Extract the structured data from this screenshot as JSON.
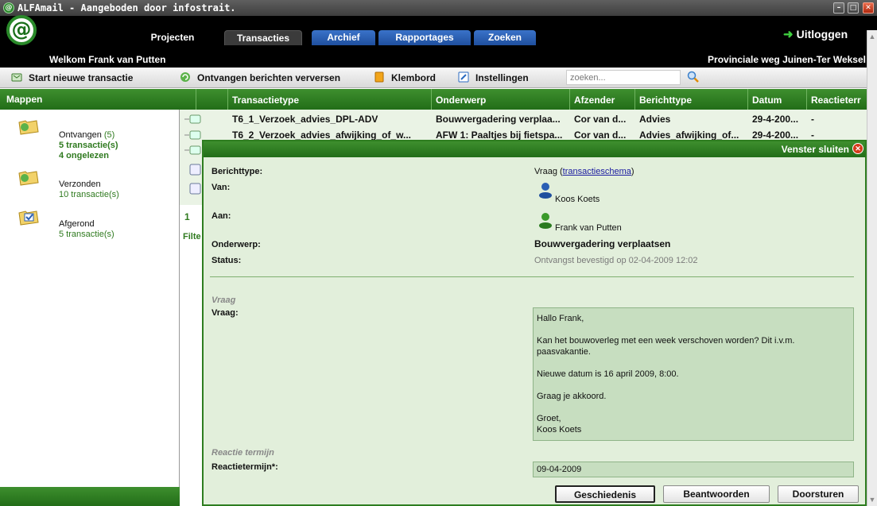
{
  "window": {
    "title": "ALFAmail - Aangeboden door infostrait."
  },
  "nav": {
    "tabs": [
      {
        "label": "Projecten"
      },
      {
        "label": "Transacties"
      },
      {
        "label": "Archief"
      },
      {
        "label": "Rapportages"
      },
      {
        "label": "Zoeken"
      }
    ],
    "logout_label": "Uitloggen",
    "welcome": "Welkom Frank van Putten",
    "location": "Provinciale weg Juinen-Ter Weksel"
  },
  "toolbar": {
    "new_transaction": "Start nieuwe transactie",
    "refresh": "Ontvangen berichten verversen",
    "clipboard": "Klembord",
    "settings": "Instellingen",
    "search_value": "zoeken..."
  },
  "sidebar": {
    "title": "Mappen",
    "folders": [
      {
        "name": "Ontvangen",
        "count": "(5)",
        "line1": "5 transactie(s)",
        "line2": "4 ongelezen"
      },
      {
        "name": "Verzonden",
        "line1": "10 transactie(s)"
      },
      {
        "name": "Afgerond",
        "line1": "5 transactie(s)"
      }
    ]
  },
  "table": {
    "headers": [
      "Transactietype",
      "Onderwerp",
      "Afzender",
      "Berichttype",
      "Datum",
      "Reactieterr"
    ],
    "rows": [
      {
        "type": "T6_1_Verzoek_advies_DPL-ADV",
        "subject": "Bouwvergadering verplaa...",
        "sender": "Cor van d...",
        "msgtype": "Advies",
        "date": "29-4-200...",
        "reaction": "-"
      },
      {
        "type": "T6_2_Verzoek_advies_afwijking_of_w...",
        "subject": "AFW 1: Paaltjes bij fietspa...",
        "sender": "Cor van d...",
        "msgtype": "Advies_afwijking_of...",
        "date": "29-4-200...",
        "reaction": "-"
      }
    ],
    "pager_text": "1",
    "filter_text": "Filte"
  },
  "modal": {
    "close_label": "Venster sluiten",
    "fields": {
      "berichttype_label": "Berichttype:",
      "berichttype_value": "Vraag (",
      "berichttype_link": "transactieschema",
      "berichttype_after": ")",
      "van_label": "Van:",
      "van_value": "Koos Koets",
      "aan_label": "Aan:",
      "aan_value": "Frank van Putten",
      "onderwerp_label": "Onderwerp:",
      "onderwerp_value": "Bouwvergadering verplaatsen",
      "status_label": "Status:",
      "status_value": "Ontvangst bevestigd op 02-04-2009 12:02"
    },
    "section_vraag": "Vraag",
    "vraag_label": "Vraag:",
    "message_lines": [
      "Hallo Frank,",
      "",
      "Kan het bouwoverleg met een week verschoven worden? Dit i.v.m. paasvakantie.",
      "",
      "Nieuwe datum is 16 april 2009, 8:00.",
      "",
      "Graag je akkoord.",
      "",
      "Groet,",
      "Koos Koets"
    ],
    "section_reactie": "Reactie termijn",
    "reactie_label": "Reactietermijn*:",
    "reactie_value": "09-04-2009",
    "buttons": {
      "history": "Geschiedenis",
      "reply": "Beantwoorden",
      "forward": "Doorsturen"
    }
  },
  "colors": {
    "header_green": "#2e7d20",
    "tab_blue": "#2a5fb4",
    "modal_bg": "#e2efdb"
  },
  "icons": [
    "app-icon",
    "logout-icon",
    "new-transaction-icon",
    "refresh-icon",
    "clipboard-icon",
    "settings-icon",
    "search-icon",
    "folder-icon",
    "person-icon",
    "close-icon"
  ]
}
